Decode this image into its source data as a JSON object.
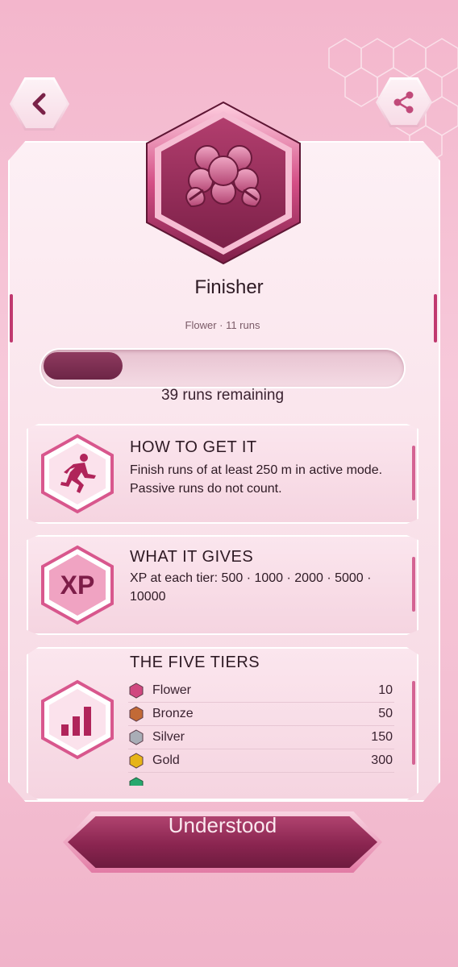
{
  "header": {
    "back_icon": "chevron-left-icon",
    "share_icon": "share-icon"
  },
  "badge": {
    "icon": "flower-emblem-icon",
    "title": "Finisher",
    "subtitle": "Flower · 11 runs",
    "progress_fraction": 0.22,
    "remaining": "39 runs remaining"
  },
  "sections": {
    "how": {
      "heading": "HOW TO GET IT",
      "body": "Finish runs of at least 250 m in active mode. Passive runs do not count.",
      "icon": "runner-icon"
    },
    "gives": {
      "heading": "WHAT IT GIVES",
      "body": "XP at each tier: 500 · 1000 · 2000 · 5000 · 10000",
      "icon_label": "XP"
    },
    "tiers": {
      "heading": "THE FIVE TIERS",
      "icon": "bar-chart-icon",
      "rows": [
        {
          "name": "Flower",
          "value": "10",
          "color": "#d0477f"
        },
        {
          "name": "Bronze",
          "value": "50",
          "color": "#c26a36"
        },
        {
          "name": "Silver",
          "value": "150",
          "color": "#a9adb6"
        },
        {
          "name": "Gold",
          "value": "300",
          "color": "#e6b417"
        }
      ],
      "partial_gem_color": "#27a86e"
    }
  },
  "footer": {
    "understood_label": "Understood"
  },
  "colors": {
    "accent": "#8a2550",
    "background": "#f7c9da"
  }
}
